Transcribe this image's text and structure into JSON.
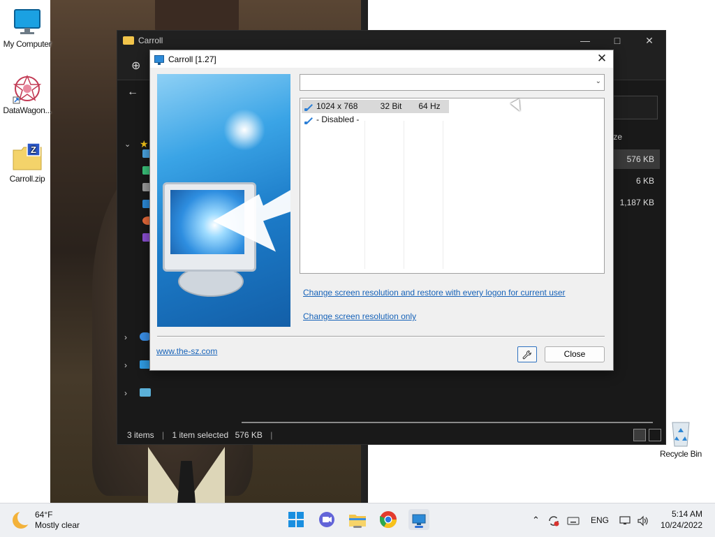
{
  "desktop": {
    "icons": [
      {
        "label": "My Computer",
        "icon": "monitor-icon"
      },
      {
        "label": "DataWagon...",
        "icon": "datawagon-icon"
      },
      {
        "label": "Carroll.zip",
        "icon": "zip-folder-icon"
      },
      {
        "label": "Recycle Bin",
        "icon": "recycle-bin-icon"
      }
    ]
  },
  "explorer": {
    "title": "Carroll",
    "column_size_header": "ize",
    "rows": [
      {
        "size": "576 KB"
      },
      {
        "size": "6 KB"
      },
      {
        "size": "1,187 KB"
      }
    ],
    "status": {
      "items": "3 items",
      "selected": "1 item selected",
      "selected_size": "576 KB"
    }
  },
  "dialog": {
    "title": "Carroll [1.27]",
    "combo_value": "",
    "list": [
      {
        "resolution": "1024 x 768",
        "depth": "32 Bit",
        "refresh": "64 Hz",
        "selected": true
      },
      {
        "resolution": "- Disabled -",
        "depth": "",
        "refresh": "",
        "selected": false
      }
    ],
    "link_restore": "Change screen resolution and restore with every logon for current user",
    "link_only": "Change screen resolution only",
    "site": "www.the-sz.com",
    "close_label": "Close",
    "tool_icon": "wrench-icon"
  },
  "taskbar": {
    "weather_temp": "64°F",
    "weather_desc": "Mostly clear",
    "language": "ENG",
    "time": "5:14 AM",
    "date": "10/24/2022",
    "apps": [
      "start",
      "teams",
      "file-explorer",
      "chrome",
      "carroll"
    ]
  },
  "colors": {
    "link": "#1662b8",
    "taskbar": "#eef0f3",
    "explorer_bg": "#191919",
    "accent": "#2c8ad8"
  }
}
